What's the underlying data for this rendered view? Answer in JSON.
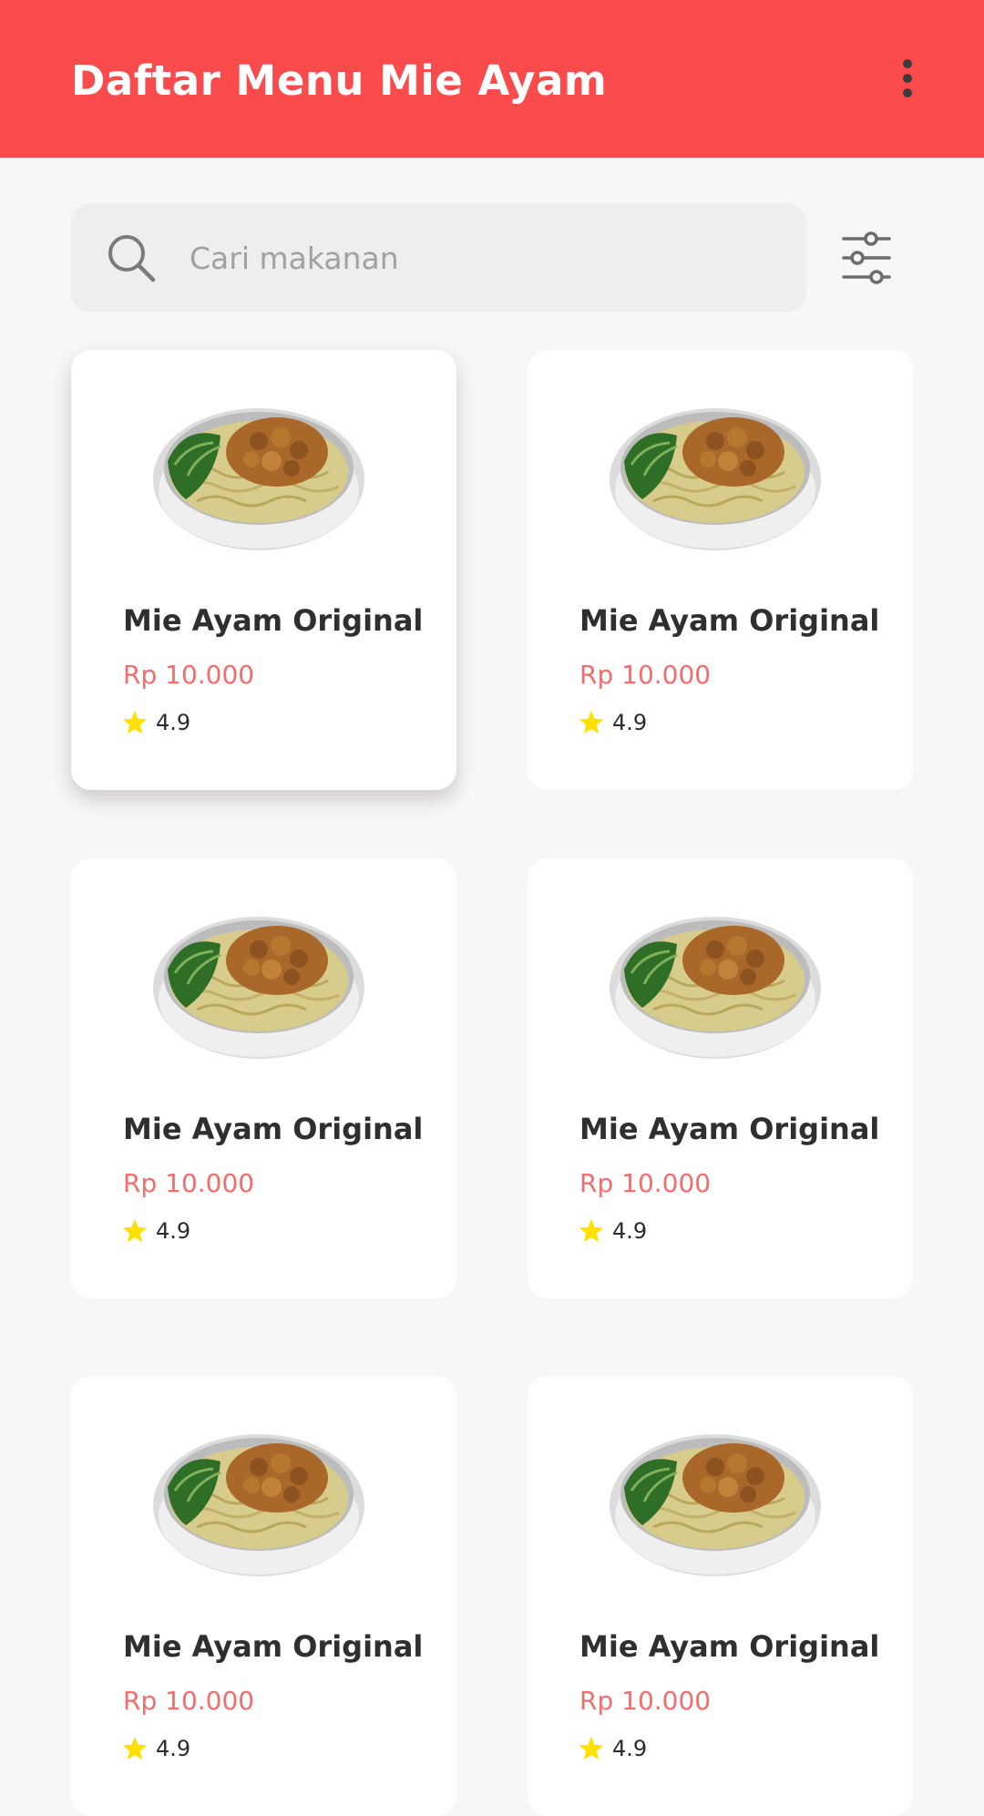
{
  "app_bar": {
    "title": "Daftar Menu Mie Ayam",
    "background": "#fa4b4c",
    "menu_icon": "more-vertical-icon"
  },
  "search": {
    "placeholder": "Cari makanan",
    "value": "",
    "icon": "search-icon",
    "filter_icon": "sliders-icon"
  },
  "colors": {
    "accent": "#fa4b4c",
    "price": "#f26d6d",
    "star": "#ffe100"
  },
  "menu_items": [
    {
      "name": "Mie Ayam Original",
      "price": "Rp 10.000",
      "rating": "4.9"
    },
    {
      "name": "Mie Ayam Original",
      "price": "Rp 10.000",
      "rating": "4.9"
    },
    {
      "name": "Mie Ayam Original",
      "price": "Rp 10.000",
      "rating": "4.9"
    },
    {
      "name": "Mie Ayam Original",
      "price": "Rp 10.000",
      "rating": "4.9"
    },
    {
      "name": "Mie Ayam Original",
      "price": "Rp 10.000",
      "rating": "4.9"
    },
    {
      "name": "Mie Ayam Original",
      "price": "Rp 10.000",
      "rating": "4.9"
    }
  ]
}
